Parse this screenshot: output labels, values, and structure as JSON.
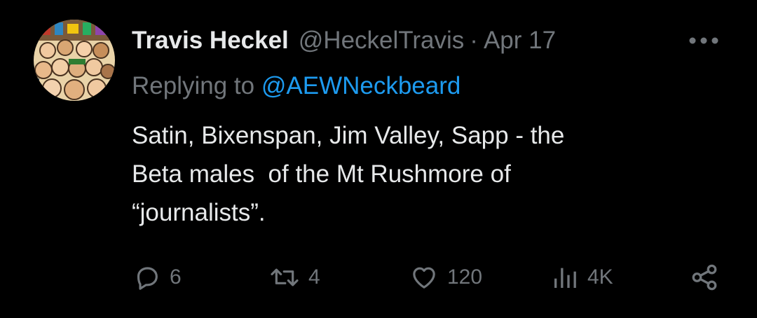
{
  "tweet": {
    "author": {
      "display_name": "Travis Heckel",
      "handle": "@HeckelTravis",
      "avatar_icon": "avatar-illustration-icon"
    },
    "separator": "·",
    "date": "Apr 17",
    "replying_prefix": "Replying to",
    "replying_to": "@AEWNeckbeard",
    "body_lines": [
      "Satin, Bixenspan, Jim Valley, Sapp - the",
      "Beta males  of the Mt Rushmore of",
      "“journalists”."
    ],
    "more_icon": "more-horizontal-icon",
    "actions": {
      "reply": {
        "icon": "reply-bubble-icon",
        "count": "6"
      },
      "retweet": {
        "icon": "retweet-icon",
        "count": "4"
      },
      "like": {
        "icon": "heart-icon",
        "count": "120"
      },
      "views": {
        "icon": "views-bars-icon",
        "count": "4K"
      },
      "share": {
        "icon": "share-icon"
      }
    }
  },
  "colors": {
    "background": "#000000",
    "primary_text": "#e7e9ea",
    "secondary_text": "#71767b",
    "accent": "#1d9bf0"
  }
}
